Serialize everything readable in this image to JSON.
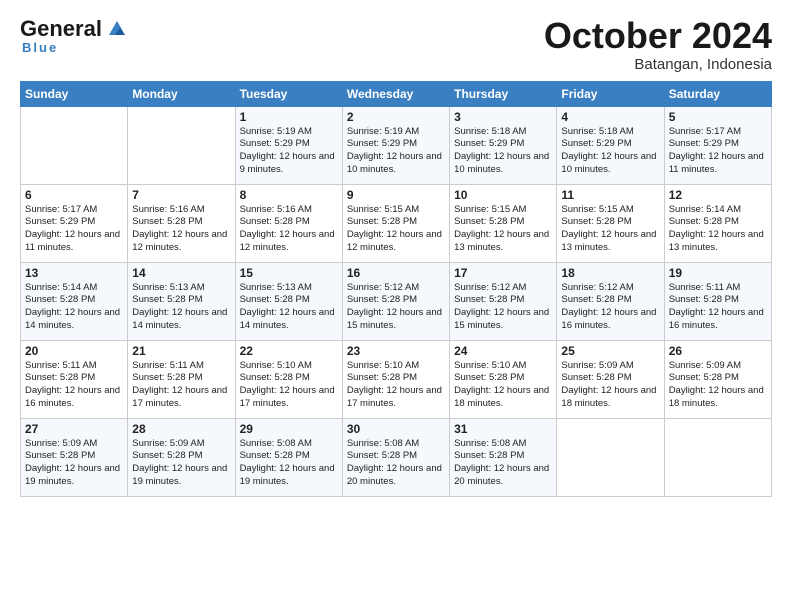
{
  "header": {
    "logo_general": "General",
    "logo_blue": "Blue",
    "month_title": "October 2024",
    "location": "Batangan, Indonesia"
  },
  "weekdays": [
    "Sunday",
    "Monday",
    "Tuesday",
    "Wednesday",
    "Thursday",
    "Friday",
    "Saturday"
  ],
  "weeks": [
    [
      null,
      null,
      {
        "day": 1,
        "sunrise": "5:19 AM",
        "sunset": "5:29 PM",
        "daylight": "12 hours and 9 minutes."
      },
      {
        "day": 2,
        "sunrise": "5:19 AM",
        "sunset": "5:29 PM",
        "daylight": "12 hours and 10 minutes."
      },
      {
        "day": 3,
        "sunrise": "5:18 AM",
        "sunset": "5:29 PM",
        "daylight": "12 hours and 10 minutes."
      },
      {
        "day": 4,
        "sunrise": "5:18 AM",
        "sunset": "5:29 PM",
        "daylight": "12 hours and 10 minutes."
      },
      {
        "day": 5,
        "sunrise": "5:17 AM",
        "sunset": "5:29 PM",
        "daylight": "12 hours and 11 minutes."
      }
    ],
    [
      {
        "day": 6,
        "sunrise": "5:17 AM",
        "sunset": "5:29 PM",
        "daylight": "12 hours and 11 minutes."
      },
      {
        "day": 7,
        "sunrise": "5:16 AM",
        "sunset": "5:28 PM",
        "daylight": "12 hours and 12 minutes."
      },
      {
        "day": 8,
        "sunrise": "5:16 AM",
        "sunset": "5:28 PM",
        "daylight": "12 hours and 12 minutes."
      },
      {
        "day": 9,
        "sunrise": "5:15 AM",
        "sunset": "5:28 PM",
        "daylight": "12 hours and 12 minutes."
      },
      {
        "day": 10,
        "sunrise": "5:15 AM",
        "sunset": "5:28 PM",
        "daylight": "12 hours and 13 minutes."
      },
      {
        "day": 11,
        "sunrise": "5:15 AM",
        "sunset": "5:28 PM",
        "daylight": "12 hours and 13 minutes."
      },
      {
        "day": 12,
        "sunrise": "5:14 AM",
        "sunset": "5:28 PM",
        "daylight": "12 hours and 13 minutes."
      }
    ],
    [
      {
        "day": 13,
        "sunrise": "5:14 AM",
        "sunset": "5:28 PM",
        "daylight": "12 hours and 14 minutes."
      },
      {
        "day": 14,
        "sunrise": "5:13 AM",
        "sunset": "5:28 PM",
        "daylight": "12 hours and 14 minutes."
      },
      {
        "day": 15,
        "sunrise": "5:13 AM",
        "sunset": "5:28 PM",
        "daylight": "12 hours and 14 minutes."
      },
      {
        "day": 16,
        "sunrise": "5:12 AM",
        "sunset": "5:28 PM",
        "daylight": "12 hours and 15 minutes."
      },
      {
        "day": 17,
        "sunrise": "5:12 AM",
        "sunset": "5:28 PM",
        "daylight": "12 hours and 15 minutes."
      },
      {
        "day": 18,
        "sunrise": "5:12 AM",
        "sunset": "5:28 PM",
        "daylight": "12 hours and 16 minutes."
      },
      {
        "day": 19,
        "sunrise": "5:11 AM",
        "sunset": "5:28 PM",
        "daylight": "12 hours and 16 minutes."
      }
    ],
    [
      {
        "day": 20,
        "sunrise": "5:11 AM",
        "sunset": "5:28 PM",
        "daylight": "12 hours and 16 minutes."
      },
      {
        "day": 21,
        "sunrise": "5:11 AM",
        "sunset": "5:28 PM",
        "daylight": "12 hours and 17 minutes."
      },
      {
        "day": 22,
        "sunrise": "5:10 AM",
        "sunset": "5:28 PM",
        "daylight": "12 hours and 17 minutes."
      },
      {
        "day": 23,
        "sunrise": "5:10 AM",
        "sunset": "5:28 PM",
        "daylight": "12 hours and 17 minutes."
      },
      {
        "day": 24,
        "sunrise": "5:10 AM",
        "sunset": "5:28 PM",
        "daylight": "12 hours and 18 minutes."
      },
      {
        "day": 25,
        "sunrise": "5:09 AM",
        "sunset": "5:28 PM",
        "daylight": "12 hours and 18 minutes."
      },
      {
        "day": 26,
        "sunrise": "5:09 AM",
        "sunset": "5:28 PM",
        "daylight": "12 hours and 18 minutes."
      }
    ],
    [
      {
        "day": 27,
        "sunrise": "5:09 AM",
        "sunset": "5:28 PM",
        "daylight": "12 hours and 19 minutes."
      },
      {
        "day": 28,
        "sunrise": "5:09 AM",
        "sunset": "5:28 PM",
        "daylight": "12 hours and 19 minutes."
      },
      {
        "day": 29,
        "sunrise": "5:08 AM",
        "sunset": "5:28 PM",
        "daylight": "12 hours and 19 minutes."
      },
      {
        "day": 30,
        "sunrise": "5:08 AM",
        "sunset": "5:28 PM",
        "daylight": "12 hours and 20 minutes."
      },
      {
        "day": 31,
        "sunrise": "5:08 AM",
        "sunset": "5:28 PM",
        "daylight": "12 hours and 20 minutes."
      },
      null,
      null
    ]
  ]
}
